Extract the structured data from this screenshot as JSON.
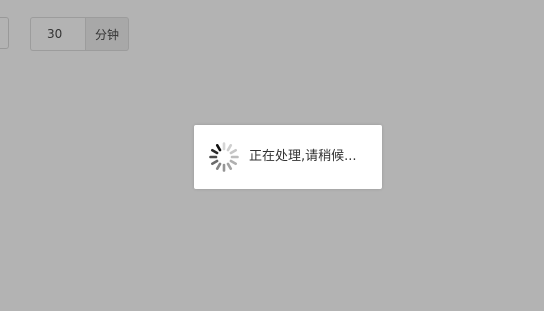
{
  "duration": {
    "value": "30",
    "unit_label": "分钟"
  },
  "loading": {
    "message": "正在处理,请稍候...",
    "icon": "spinner-icon"
  },
  "colors": {
    "overlay": "#b3b3b3",
    "dialog": "#ffffff",
    "text": "#333333"
  }
}
